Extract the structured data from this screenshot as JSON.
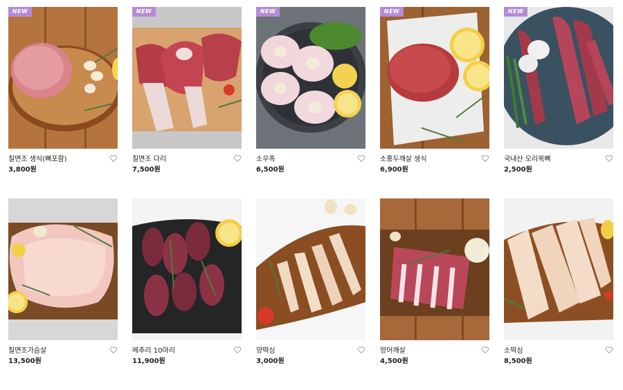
{
  "products": [
    {
      "name": "칠면조 생식(뼈포함)",
      "price": "3,800원",
      "badge": "NEW"
    },
    {
      "name": "칠면조 다리",
      "price": "7,500원",
      "badge": "NEW"
    },
    {
      "name": "소우족",
      "price": "6,500원",
      "badge": "NEW"
    },
    {
      "name": "소홍두깨살 생식",
      "price": "6,900원",
      "badge": "NEW"
    },
    {
      "name": "국내산 오리목뼈",
      "price": "2,500원",
      "badge": "NEW"
    },
    {
      "name": "칠면조가슴살",
      "price": "13,500원",
      "badge": ""
    },
    {
      "name": "메추리 10마리",
      "price": "11,900원",
      "badge": ""
    },
    {
      "name": "양떡심",
      "price": "3,000원",
      "badge": ""
    },
    {
      "name": "양어깨살",
      "price": "4,500원",
      "badge": ""
    },
    {
      "name": "소떡심",
      "price": "8,500원",
      "badge": ""
    }
  ],
  "icons": {
    "wishlist": "heart-outline-icon"
  },
  "colors": {
    "badge": "#b48bd8"
  }
}
